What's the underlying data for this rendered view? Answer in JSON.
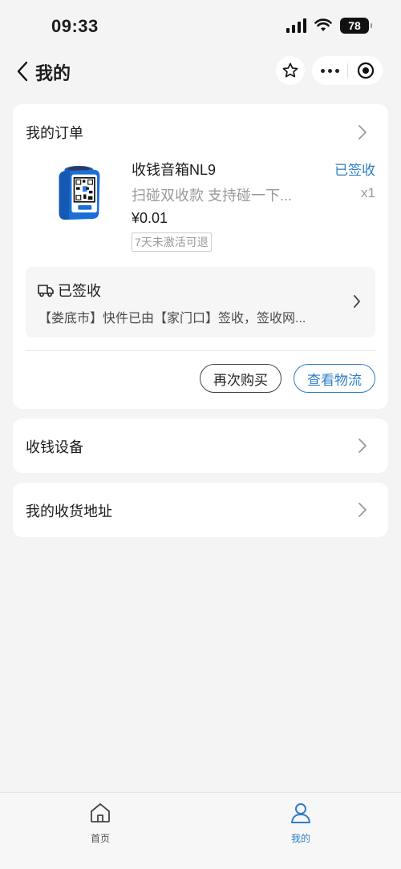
{
  "status_bar": {
    "time": "09:33",
    "battery": "78"
  },
  "nav": {
    "title": "我的"
  },
  "order": {
    "section_title": "我的订单",
    "product_name": "收钱音箱NL9",
    "status": "已签收",
    "description": "扫碰双收款  支持碰一下...",
    "quantity": "x1",
    "price": "¥0.01",
    "tag": "7天未激活可退",
    "logistics_title": "已签收",
    "logistics_text": "【娄底市】快件已由【家门口】签收，签收网...",
    "rebuy_label": "再次购买",
    "view_logistics_label": "查看物流"
  },
  "menu": {
    "devices_label": "收钱设备",
    "address_label": "我的收货地址"
  },
  "tabbar": {
    "home_label": "首页",
    "mine_label": "我的"
  },
  "colors": {
    "accent": "#2f7ec7",
    "background": "#f4f4f5"
  }
}
